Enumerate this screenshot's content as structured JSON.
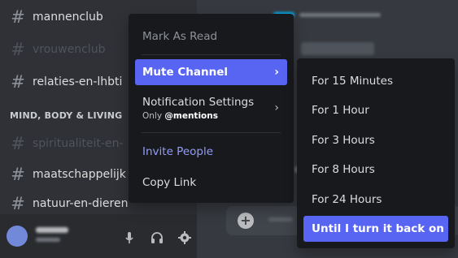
{
  "sidebar": {
    "channels_top": [
      {
        "name": "mannenclub",
        "muted": false
      },
      {
        "name": "vrouwenclub",
        "muted": true
      },
      {
        "name": "relaties-en-lhbti",
        "muted": false
      }
    ],
    "category": "MIND, BODY & LIVING",
    "channels_bottom": [
      {
        "name": "spiritualiteit-en-",
        "muted": true
      },
      {
        "name": "maatschappelijk",
        "muted": false
      },
      {
        "name": "natuur-en-dieren",
        "muted": false
      }
    ],
    "hash_glyph": "#"
  },
  "context_menu": {
    "mark_as_read": "Mark As Read",
    "mute_channel": "Mute Channel",
    "notification_settings": "Notification Settings",
    "notification_sub_prefix": "Only ",
    "notification_sub_value": "@mentions",
    "invite_people": "Invite People",
    "copy_link": "Copy Link",
    "chevron": "›"
  },
  "mute_submenu": [
    "For 15 Minutes",
    "For 1 Hour",
    "For 3 Hours",
    "For 8 Hours",
    "For 24 Hours",
    "Until I turn it back on"
  ],
  "composer": {
    "plus_glyph": "+"
  },
  "colors": {
    "accent": "#5865f2",
    "menu_bg": "#18191c",
    "sidebar_bg": "#2f3136",
    "chat_bg": "#36393f",
    "invite_text": "#949cf7"
  },
  "icons": [
    "microphone-icon",
    "headphones-icon",
    "gear-icon",
    "chevron-right-icon",
    "hashtag-icon",
    "add-attachment-icon"
  ]
}
